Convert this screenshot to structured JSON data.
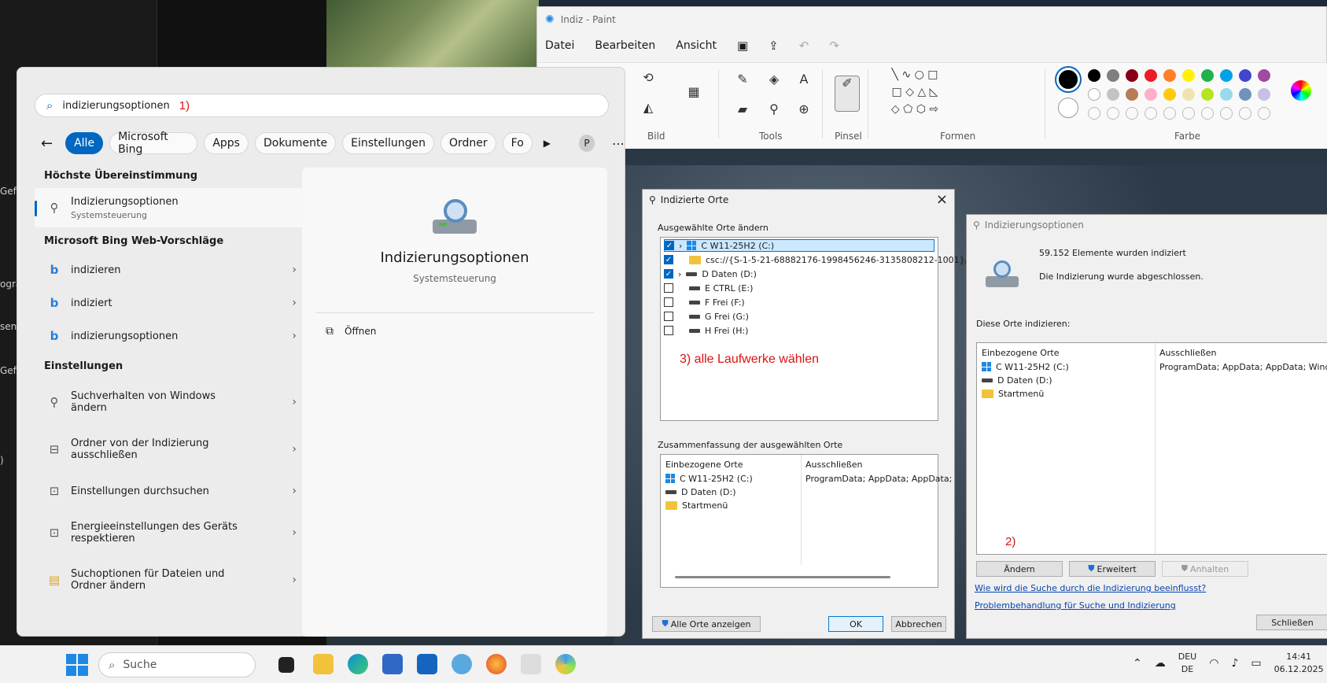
{
  "paint": {
    "title": "Indiz - Paint",
    "menu": [
      "Datei",
      "Bearbeiten",
      "Ansicht"
    ],
    "groups": {
      "bild": "Bild",
      "tools": "Tools",
      "pinsel": "Pinsel",
      "formen": "Formen",
      "farbe": "Farbe"
    },
    "colors_row1": [
      "#000000",
      "#7f7f7f",
      "#880015",
      "#ed1c24",
      "#ff7f27",
      "#fff200",
      "#22b14c",
      "#00a2e8",
      "#3f48cc",
      "#a349a4"
    ],
    "colors_row2": [
      "#ffffff",
      "#c3c3c3",
      "#b97a57",
      "#ffaec9",
      "#ffc90e",
      "#efe4b0",
      "#b5e61d",
      "#99d9ea",
      "#7092be",
      "#c8bfe7"
    ]
  },
  "edge": {
    "t1": "Gefä",
    "t2": "ogra",
    "t3": "sen",
    "t4": "Gefä",
    "t5": ")"
  },
  "start": {
    "search_text": "indizierungsoptionen",
    "annotation": "1)",
    "filters": [
      "Alle",
      "Microsoft Bing",
      "Apps",
      "Dokumente",
      "Einstellungen",
      "Ordner",
      "Fo"
    ],
    "profile": "P",
    "best_match_title": "Höchste Übereinstimmung",
    "best_match": {
      "name": "Indizierungsoptionen",
      "sub": "Systemsteuerung"
    },
    "bing_title": "Microsoft Bing Web-Vorschläge",
    "bing_items": [
      "indizieren",
      "indiziert",
      "indizierungsoptionen"
    ],
    "settings_title": "Einstellungen",
    "settings_items": [
      {
        "l1": "Suchverhalten von Windows",
        "l2": "ändern"
      },
      {
        "l1": "Ordner von der Indizierung",
        "l2": "ausschließen"
      },
      {
        "l1": "Einstellungen durchsuchen",
        "l2": ""
      },
      {
        "l1": "Energieeinstellungen des Geräts",
        "l2": "respektieren"
      },
      {
        "l1": "Suchoptionen für Dateien und",
        "l2": "Ordner ändern"
      }
    ],
    "preview": {
      "title": "Indizierungsoptionen",
      "sub": "Systemsteuerung",
      "open": "Öffnen"
    }
  },
  "indexed": {
    "title": "Indizierte Orte",
    "change_group": "Ausgewählte Orte ändern",
    "items": [
      {
        "label": "C W11-25H2 (C:)",
        "checked": true
      },
      {
        "label": "csc://{S-1-5-21-68882176-1998456246-3135808212-1001}/",
        "checked": true
      },
      {
        "label": "D Daten (D:)",
        "checked": true
      },
      {
        "label": "E CTRL (E:)",
        "checked": false
      },
      {
        "label": "F Frei (F:)",
        "checked": false
      },
      {
        "label": "G Frei (G:)",
        "checked": false
      },
      {
        "label": "H Frei (H:)",
        "checked": false
      }
    ],
    "annotation": "3) alle Laufwerke wählen",
    "summary_group": "Zusammenfassung der ausgewählten Orte",
    "col_included": "Einbezogene Orte",
    "col_excluded": "Ausschließen",
    "summary": [
      "C W11-25H2 (C:)",
      "D Daten (D:)",
      "Startmenü"
    ],
    "excluded_text": "ProgramData; AppData; AppData;",
    "btn_show_all": "Alle Orte anzeigen",
    "btn_ok": "OK",
    "btn_cancel": "Abbrechen"
  },
  "options": {
    "title": "Indizierungsoptionen",
    "count": "59.152 Elemente wurden indiziert",
    "status": "Die Indizierung wurde abgeschlossen.",
    "index_label": "Diese Orte indizieren:",
    "col_included": "Einbezogene Orte",
    "col_excluded": "Ausschließen",
    "locations": [
      "C W11-25H2 (C:)",
      "D Daten (D:)",
      "Startmenü"
    ],
    "excluded_text": "ProgramData; AppData; AppData; Windows",
    "annotation": "2)",
    "btn_change": "Ändern",
    "btn_advanced": "Erweitert",
    "btn_pause": "Anhalten",
    "link1": "Wie wird die Suche durch die Indizierung beeinflusst?",
    "link2": "Problembehandlung für Suche und Indizierung",
    "btn_close": "Schließen"
  },
  "taskbar": {
    "search": "Suche",
    "lang1": "DEU",
    "lang2": "DE",
    "time": "14:41",
    "date": "06.12.2025"
  }
}
